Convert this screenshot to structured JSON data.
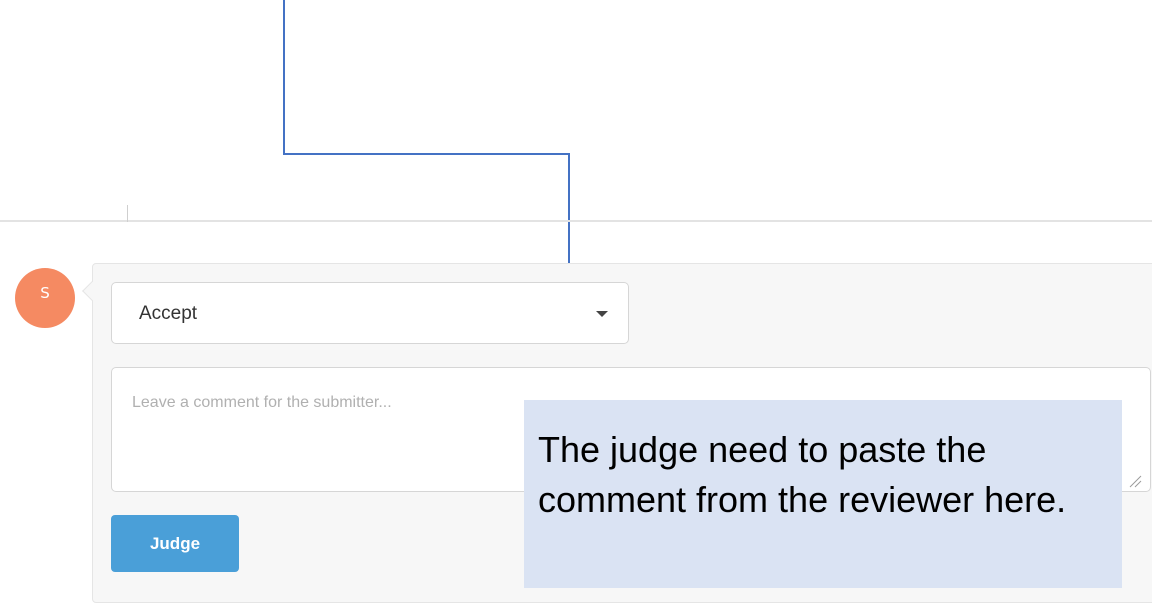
{
  "avatar": {
    "initial": "S",
    "color": "#f58a62"
  },
  "decision_select": {
    "selected": "Accept"
  },
  "comment": {
    "placeholder": "Leave a comment for the submitter..."
  },
  "judge_button": {
    "label": "Judge",
    "color": "#4a9fd8"
  },
  "annotation": {
    "text": "The judge need to paste the comment from the reviewer here.",
    "background": "#dae3f3",
    "arrow_color": "#4472c4"
  }
}
